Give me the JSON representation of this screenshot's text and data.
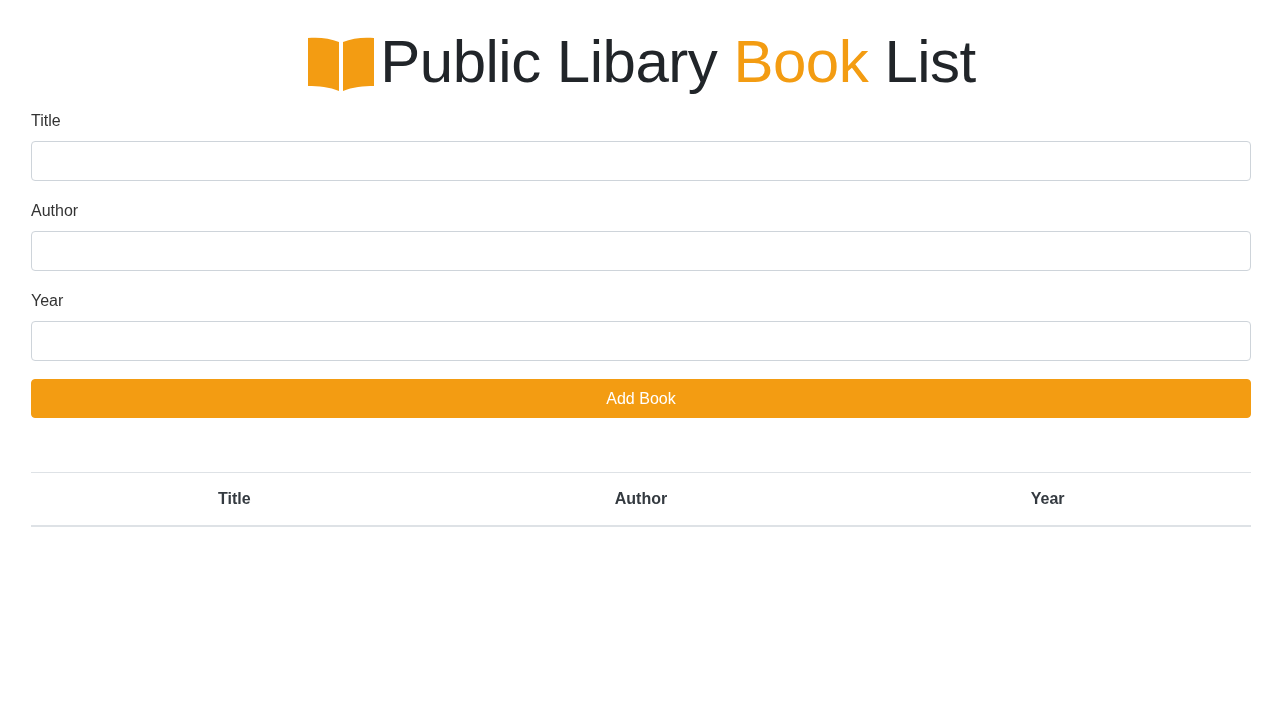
{
  "header": {
    "title_lead": "Public Libary",
    "title_highlight": "Book",
    "title_tail": "List"
  },
  "form": {
    "fields": [
      {
        "label": "Title"
      },
      {
        "label": "Author"
      },
      {
        "label": "Year"
      }
    ],
    "submit_button": "Add Book"
  },
  "table": {
    "columns": [
      "Title",
      "Author",
      "Year"
    ]
  }
}
